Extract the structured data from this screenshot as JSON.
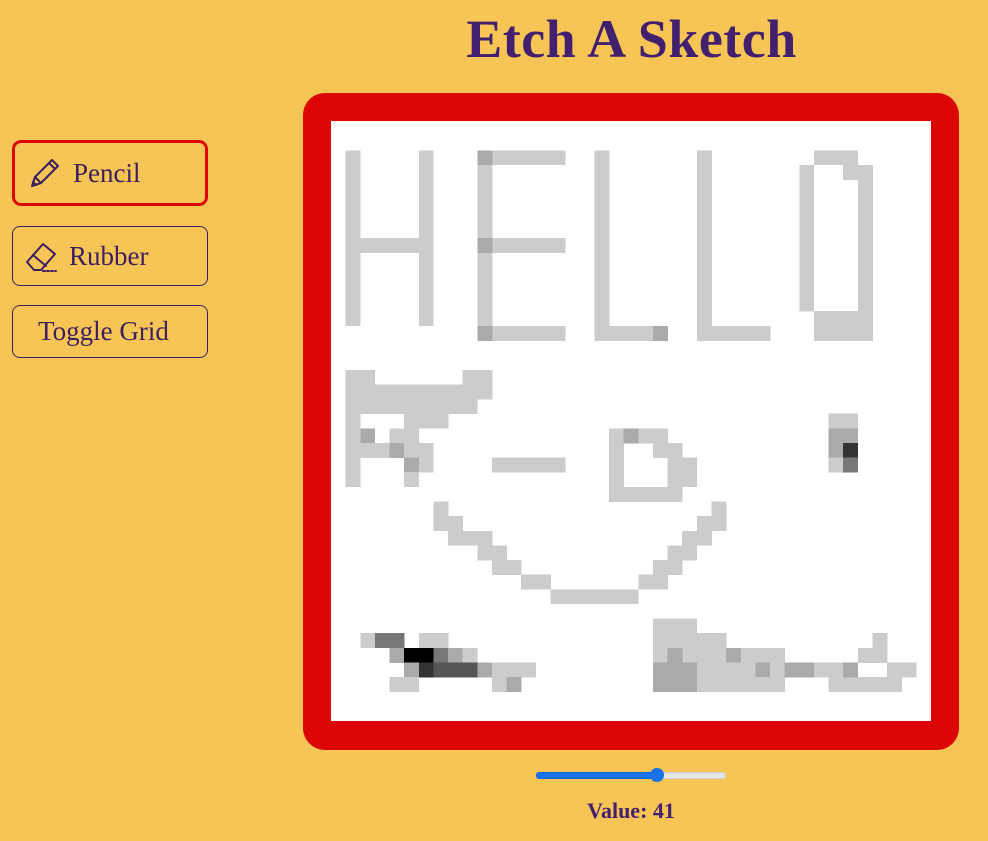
{
  "title": "Etch A Sketch",
  "tools": {
    "pencil": {
      "label": "Pencil",
      "icon": "pencil-icon",
      "active": true
    },
    "rubber": {
      "label": "Rubber",
      "icon": "eraser-icon"
    },
    "toggle_grid": {
      "label": "Toggle Grid"
    }
  },
  "colors": {
    "background": "#f7c556",
    "frame": "#dc0505",
    "text": "#43206e",
    "slider_accent": "#1a73e8"
  },
  "slider": {
    "min": 1,
    "max": 64,
    "value": 41
  },
  "value_display": {
    "prefix": "Value:",
    "value": "41",
    "text": "Value: 41"
  },
  "canvas": {
    "grid_size": 41,
    "cells": [
      {
        "c": 1,
        "r": 2,
        "h": 12,
        "s": "#cccccc"
      },
      {
        "c": 6,
        "r": 2,
        "h": 12,
        "s": "#cccccc"
      },
      {
        "c": 1,
        "r": 8,
        "w": 6,
        "s": "#cccccc"
      },
      {
        "c": 10,
        "r": 2,
        "h": 13,
        "s": "#cccccc"
      },
      {
        "c": 10,
        "r": 2,
        "w": 6,
        "s": "#cccccc"
      },
      {
        "c": 10,
        "r": 8,
        "w": 6,
        "s": "#cccccc"
      },
      {
        "c": 10,
        "r": 14,
        "w": 6,
        "s": "#cccccc"
      },
      {
        "c": 10,
        "r": 2,
        "s": "#aaaaaa"
      },
      {
        "c": 10,
        "r": 8,
        "s": "#aaaaaa"
      },
      {
        "c": 10,
        "r": 14,
        "s": "#aaaaaa"
      },
      {
        "c": 18,
        "r": 2,
        "h": 12,
        "s": "#cccccc"
      },
      {
        "c": 18,
        "r": 14,
        "w": 5,
        "s": "#cccccc"
      },
      {
        "c": 22,
        "r": 14,
        "s": "#aaaaaa"
      },
      {
        "c": 25,
        "r": 2,
        "h": 12,
        "s": "#cccccc"
      },
      {
        "c": 25,
        "r": 14,
        "w": 5,
        "s": "#cccccc"
      },
      {
        "c": 33,
        "r": 2,
        "w": 3,
        "s": "#cccccc"
      },
      {
        "c": 32,
        "r": 3,
        "h": 10,
        "s": "#cccccc"
      },
      {
        "c": 35,
        "r": 3,
        "w": 2,
        "s": "#cccccc"
      },
      {
        "c": 36,
        "r": 4,
        "h": 10,
        "s": "#cccccc"
      },
      {
        "c": 33,
        "r": 13,
        "w": 3,
        "s": "#cccccc"
      },
      {
        "c": 33,
        "r": 14,
        "w": 4,
        "s": "#cccccc"
      },
      {
        "c": 1,
        "r": 17,
        "w": 2,
        "s": "#cccccc"
      },
      {
        "c": 1,
        "r": 18,
        "w": 10,
        "s": "#cccccc"
      },
      {
        "c": 9,
        "r": 17,
        "w": 2,
        "s": "#cccccc"
      },
      {
        "c": 1,
        "r": 19,
        "h": 2,
        "s": "#cccccc"
      },
      {
        "c": 2,
        "r": 19,
        "w": 8,
        "s": "#cccccc"
      },
      {
        "c": 5,
        "r": 20,
        "w": 3,
        "s": "#cccccc"
      },
      {
        "c": 1,
        "r": 21,
        "w": 2,
        "s": "#cccccc"
      },
      {
        "c": 2,
        "r": 21,
        "s": "#aaaaaa"
      },
      {
        "c": 4,
        "r": 21,
        "w": 2,
        "s": "#cccccc"
      },
      {
        "c": 1,
        "r": 22,
        "h": 3,
        "s": "#cccccc"
      },
      {
        "c": 2,
        "r": 22,
        "w": 2,
        "s": "#cccccc"
      },
      {
        "c": 4,
        "r": 22,
        "s": "#aaaaaa"
      },
      {
        "c": 5,
        "r": 22,
        "w": 2,
        "s": "#cccccc"
      },
      {
        "c": 5,
        "r": 23,
        "w": 2,
        "s": "#cccccc"
      },
      {
        "c": 5,
        "r": 23,
        "s": "#aaaaaa"
      },
      {
        "c": 5,
        "r": 24,
        "s": "#cccccc"
      },
      {
        "c": 11,
        "r": 23,
        "w": 5,
        "s": "#cccccc"
      },
      {
        "c": 19,
        "r": 21,
        "w": 4,
        "s": "#cccccc"
      },
      {
        "c": 20,
        "r": 21,
        "s": "#aaaaaa"
      },
      {
        "c": 19,
        "r": 22,
        "h": 3,
        "s": "#cccccc"
      },
      {
        "c": 22,
        "r": 22,
        "w": 2,
        "s": "#cccccc"
      },
      {
        "c": 23,
        "r": 23,
        "w": 2,
        "s": "#cccccc"
      },
      {
        "c": 19,
        "r": 25,
        "w": 5,
        "s": "#cccccc"
      },
      {
        "c": 23,
        "r": 24,
        "w": 2,
        "s": "#cccccc"
      },
      {
        "c": 34,
        "r": 20,
        "w": 2,
        "s": "#cccccc"
      },
      {
        "c": 34,
        "r": 21,
        "w": 2,
        "s": "#aaaaaa"
      },
      {
        "c": 34,
        "r": 22,
        "s": "#aaaaaa"
      },
      {
        "c": 35,
        "r": 22,
        "s": "#333333"
      },
      {
        "c": 34,
        "r": 23,
        "s": "#cccccc"
      },
      {
        "c": 35,
        "r": 23,
        "s": "#777777"
      },
      {
        "c": 7,
        "r": 26,
        "h": 2,
        "s": "#cccccc"
      },
      {
        "c": 8,
        "r": 27,
        "h": 2,
        "s": "#cccccc"
      },
      {
        "c": 9,
        "r": 28,
        "w": 2,
        "s": "#cccccc"
      },
      {
        "c": 10,
        "r": 29,
        "w": 2,
        "s": "#cccccc"
      },
      {
        "c": 11,
        "r": 30,
        "w": 2,
        "s": "#cccccc"
      },
      {
        "c": 13,
        "r": 31,
        "w": 2,
        "s": "#cccccc"
      },
      {
        "c": 15,
        "r": 32,
        "w": 6,
        "s": "#cccccc"
      },
      {
        "c": 21,
        "r": 31,
        "w": 2,
        "s": "#cccccc"
      },
      {
        "c": 22,
        "r": 30,
        "w": 2,
        "s": "#cccccc"
      },
      {
        "c": 23,
        "r": 29,
        "w": 2,
        "s": "#cccccc"
      },
      {
        "c": 24,
        "r": 28,
        "w": 2,
        "s": "#cccccc"
      },
      {
        "c": 25,
        "r": 27,
        "w": 2,
        "s": "#cccccc"
      },
      {
        "c": 26,
        "r": 26,
        "s": "#cccccc"
      },
      {
        "c": 2,
        "r": 35,
        "s": "#cccccc"
      },
      {
        "c": 3,
        "r": 35,
        "w": 2,
        "s": "#777777"
      },
      {
        "c": 6,
        "r": 35,
        "w": 2,
        "s": "#cccccc"
      },
      {
        "c": 4,
        "r": 36,
        "s": "#aaaaaa"
      },
      {
        "c": 5,
        "r": 36,
        "w": 2,
        "s": "#000000"
      },
      {
        "c": 7,
        "r": 36,
        "s": "#777777"
      },
      {
        "c": 8,
        "r": 36,
        "s": "#aaaaaa"
      },
      {
        "c": 9,
        "r": 36,
        "s": "#cccccc"
      },
      {
        "c": 5,
        "r": 37,
        "s": "#aaaaaa"
      },
      {
        "c": 6,
        "r": 37,
        "s": "#333333"
      },
      {
        "c": 7,
        "r": 37,
        "w": 3,
        "s": "#555555"
      },
      {
        "c": 10,
        "r": 37,
        "s": "#aaaaaa"
      },
      {
        "c": 11,
        "r": 37,
        "w": 3,
        "s": "#cccccc"
      },
      {
        "c": 4,
        "r": 38,
        "w": 2,
        "s": "#cccccc"
      },
      {
        "c": 11,
        "r": 38,
        "s": "#cccccc"
      },
      {
        "c": 12,
        "r": 38,
        "s": "#aaaaaa"
      },
      {
        "c": 22,
        "r": 34,
        "w": 3,
        "s": "#cccccc"
      },
      {
        "c": 22,
        "r": 35,
        "w": 5,
        "s": "#cccccc"
      },
      {
        "c": 22,
        "r": 36,
        "w": 7,
        "s": "#cccccc"
      },
      {
        "c": 23,
        "r": 36,
        "s": "#aaaaaa"
      },
      {
        "c": 27,
        "r": 36,
        "s": "#aaaaaa"
      },
      {
        "c": 29,
        "r": 36,
        "w": 2,
        "s": "#cccccc"
      },
      {
        "c": 22,
        "r": 37,
        "w": 3,
        "s": "#aaaaaa"
      },
      {
        "c": 25,
        "r": 37,
        "w": 4,
        "s": "#cccccc"
      },
      {
        "c": 29,
        "r": 37,
        "s": "#aaaaaa"
      },
      {
        "c": 30,
        "r": 37,
        "w": 2,
        "s": "#cccccc"
      },
      {
        "c": 31,
        "r": 37,
        "w": 2,
        "s": "#aaaaaa"
      },
      {
        "c": 33,
        "r": 37,
        "w": 2,
        "s": "#cccccc"
      },
      {
        "c": 22,
        "r": 38,
        "w": 3,
        "s": "#aaaaaa"
      },
      {
        "c": 25,
        "r": 38,
        "w": 6,
        "s": "#cccccc"
      },
      {
        "c": 34,
        "r": 38,
        "w": 5,
        "s": "#cccccc"
      },
      {
        "c": 35,
        "r": 37,
        "s": "#aaaaaa"
      },
      {
        "c": 36,
        "r": 36,
        "w": 2,
        "s": "#cccccc"
      },
      {
        "c": 37,
        "r": 35,
        "s": "#cccccc"
      },
      {
        "c": 38,
        "r": 37,
        "w": 2,
        "s": "#cccccc"
      }
    ]
  }
}
